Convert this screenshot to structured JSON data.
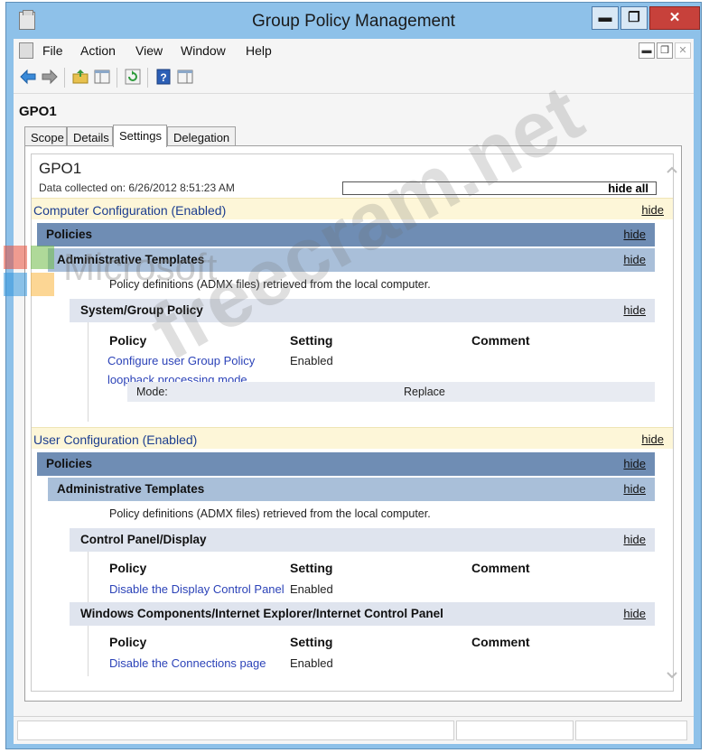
{
  "window": {
    "title": "Group Policy Management",
    "min_label": "▬",
    "max_label": "❐",
    "close_label": "✕"
  },
  "menu": {
    "items": [
      "File",
      "Action",
      "View",
      "Window",
      "Help"
    ],
    "mdi_min": "▬",
    "mdi_restore": "❐",
    "mdi_close": "✕"
  },
  "toolbar": {
    "icons": [
      "back-arrow-icon",
      "forward-arrow-icon",
      "up-folder-icon",
      "show-hide-console-tree-icon",
      "refresh-icon",
      "help-icon",
      "action-pane-icon"
    ]
  },
  "gpo": {
    "name": "GPO1",
    "tabs": [
      "Scope",
      "Details",
      "Settings",
      "Delegation"
    ],
    "active_tab": "Settings"
  },
  "report": {
    "title": "GPO1",
    "collected": "Data collected on: 6/26/2012 8:51:23 AM",
    "hide_all": "hide all",
    "hide": "hide",
    "computer": {
      "label": "Computer Configuration (Enabled)",
      "policies": "Policies",
      "admin_templates": "Administrative Templates",
      "admx_note": "Policy definitions (ADMX files) retrieved from the local computer.",
      "section": "System/Group Policy",
      "col_policy": "Policy",
      "col_setting": "Setting",
      "col_comment": "Comment",
      "policy_line1": "Configure user Group Policy",
      "policy_line2": "loopback processing mode",
      "policy_value": "Enabled",
      "mode_label": "Mode:",
      "mode_value": "Replace"
    },
    "user": {
      "label": "User Configuration (Enabled)",
      "policies": "Policies",
      "admin_templates": "Administrative Templates",
      "admx_note": "Policy definitions (ADMX files) retrieved from the local computer.",
      "section1": "Control Panel/Display",
      "s1_policy": "Disable the Display Control Panel",
      "s1_value": "Enabled",
      "section2": "Windows Components/Internet Explorer/Internet Control Panel",
      "s2_policy": "Disable the Connections page",
      "s2_value": "Enabled",
      "col_policy": "Policy",
      "col_setting": "Setting",
      "col_comment": "Comment"
    }
  },
  "watermark": {
    "brand": "Microsoft",
    "site": "freecram.net"
  },
  "colors": {
    "frame": "#8ec1e9",
    "close_button": "#c7413b",
    "config_band": "#fdf6d8",
    "policies_band": "#6f8db4",
    "admin_band": "#a9bfd9",
    "section_band": "#dfe4ee",
    "link": "#2c43b8"
  }
}
